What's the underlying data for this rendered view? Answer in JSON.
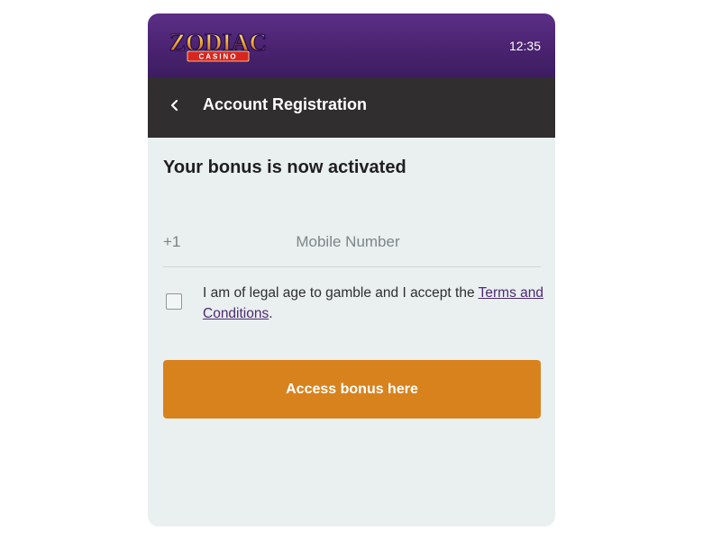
{
  "app": {
    "logo_main": "ZODIAC",
    "logo_sub": "CASINO",
    "clock": "12:35"
  },
  "nav": {
    "title": "Account Registration",
    "back_icon": "chevron-left-icon"
  },
  "main": {
    "heading": "Your bonus is now activated",
    "country_code": "+1",
    "mobile_placeholder": "Mobile Number",
    "mobile_value": "",
    "consent_text": "I am of legal age to gamble and I accept the ",
    "terms_link": "Terms and Conditions",
    "consent_end": ".",
    "consent_checked": false,
    "cta_label": "Access bonus here"
  },
  "colors": {
    "header_purple": "#4a2370",
    "nav_dark": "#302e2f",
    "background": "#eaeff0",
    "cta_orange": "#d8821e",
    "link_purple": "#4b2a72"
  }
}
